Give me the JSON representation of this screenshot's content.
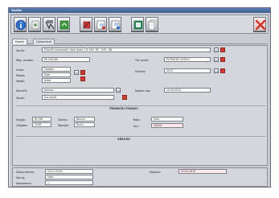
{
  "window": {
    "title": "Vozila"
  },
  "toolbar": {
    "buttons": [
      {
        "icon": "info-icon"
      },
      {
        "icon": "add-icon"
      },
      {
        "icon": "save-icon"
      },
      {
        "icon": "refresh-icon"
      },
      {
        "icon": "tool-icon"
      },
      {
        "icon": "export-icon"
      },
      {
        "icon": "import-icon"
      },
      {
        "icon": "print-icon"
      },
      {
        "icon": "copy-icon"
      },
      {
        "icon": "close-icon"
      }
    ]
  },
  "tabs": [
    "Podaci",
    "Dokumenti"
  ],
  "form": {
    "row1_label": "Vozilo:",
    "row1_value": "Putnički automobil, Opel Astra 1.6 16V, PS - 243 - AB",
    "row2_label": "Reg. oznaka:",
    "row2_value": "PS-243-AB",
    "row2_right_label": "Tip vozila:",
    "row2_right_value": "PUTNIČKO VOZILO",
    "row3a_label": "Vrsta:",
    "row3a_value": "Osobno",
    "row3b_label": "Marka:",
    "row3b_value": "Opel",
    "row3c_label": "Model:",
    "row3c_value": "Astra",
    "row3_right_label": "Godina:",
    "row3_right_value": "2012",
    "row4_label": "Korisnik:",
    "row4_value": "Uprava",
    "row4_right_label": "Datum reg.:",
    "row4_right_value": "15.03.2012",
    "row5_label": "Vozač:",
    "row5_value": "Ivo Ivanić",
    "section1": "TEHNIČKI PODACI",
    "tech": [
      {
        "label": "Snaga:",
        "value": "85 kW"
      },
      {
        "label": "Obujam:",
        "value": "1598"
      },
      {
        "label": "Gorivo:",
        "value": "Benzin"
      },
      {
        "label": "Mjenjač:",
        "value": "Ručni"
      }
    ],
    "tech_right_label": "Boja:",
    "tech_right_value": "Siva",
    "tech_right2_label": "Km:",
    "tech_right2_value": "45000",
    "section2": "SERVISI",
    "lower": [
      {
        "label": "Zadnji servis:",
        "value": "12.01.2014"
      },
      {
        "label": "Servis:",
        "value": "Opel"
      },
      {
        "label": "Napomena:",
        "value": "—"
      }
    ],
    "lower_right_label": "Sljedeći:",
    "lower_right_value": "12.01.2015"
  }
}
